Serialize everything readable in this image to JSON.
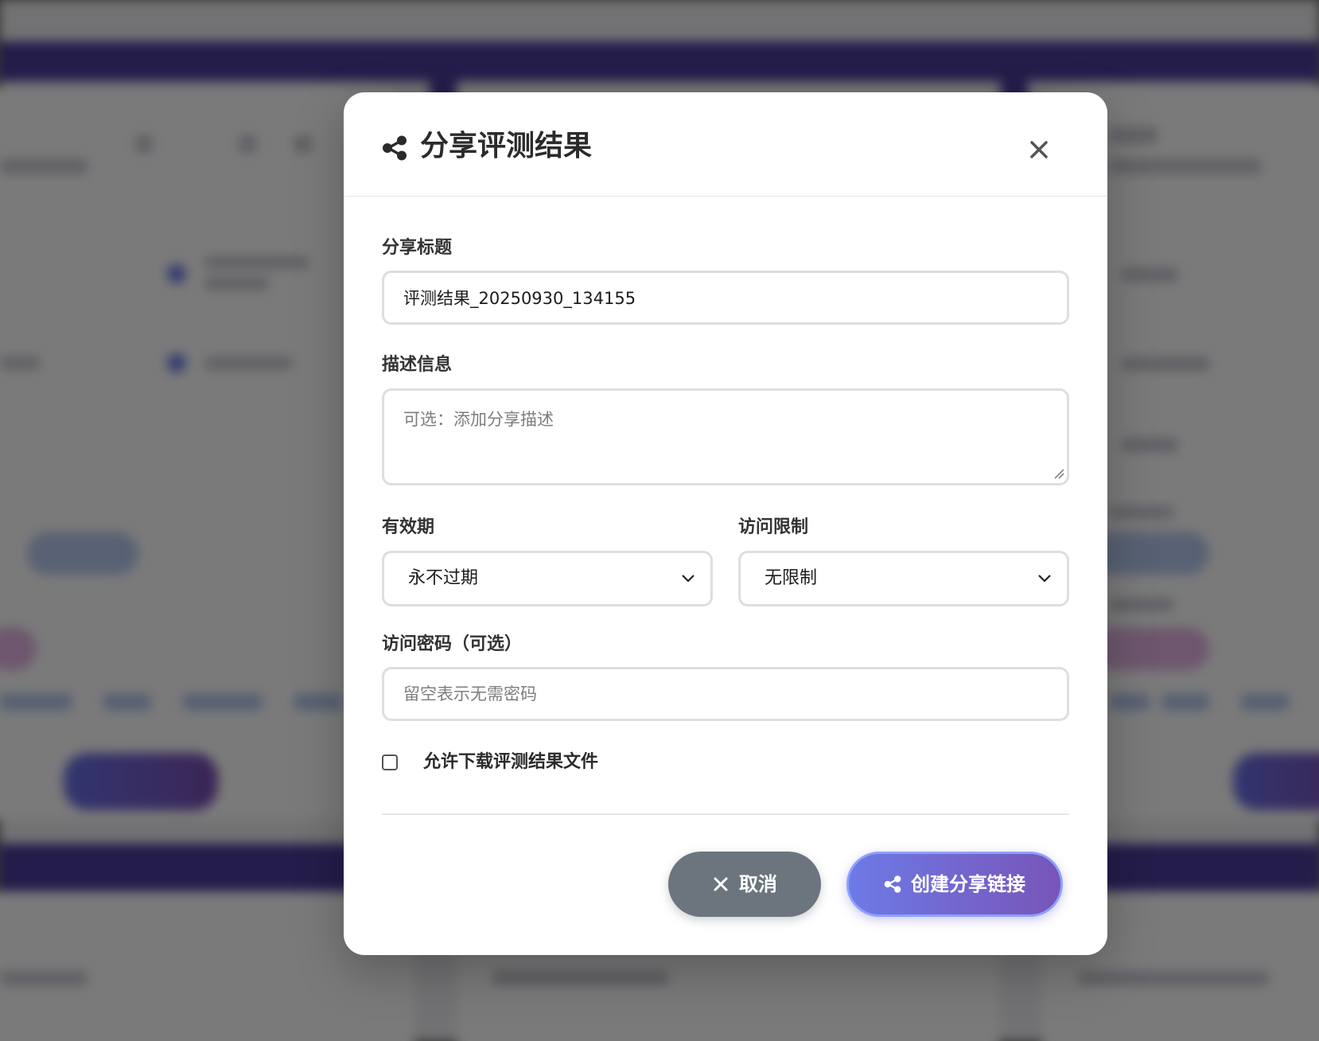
{
  "modal": {
    "title": "分享评测结果",
    "title_icon": "share-icon",
    "close_icon": "close-icon"
  },
  "form": {
    "share_title": {
      "label": "分享标题",
      "value": "评测结果_20250930_134155"
    },
    "description": {
      "label": "描述信息",
      "placeholder": "可选：添加分享描述"
    },
    "expiry": {
      "label": "有效期",
      "selected": "永不过期"
    },
    "access_limit": {
      "label": "访问限制",
      "selected": "无限制"
    },
    "password": {
      "label": "访问密码（可选）",
      "placeholder": "留空表示无需密码"
    },
    "allow_download": {
      "label": "允许下载评测结果文件",
      "checked": false
    }
  },
  "actions": {
    "cancel_label": "取消",
    "create_label": "创建分享链接"
  },
  "colors": {
    "cancel_button": "#6c757d",
    "create_gradient_start": "#6d7ae6",
    "create_gradient_end": "#7855b8",
    "backdrop_band": "#4b3c9c"
  }
}
